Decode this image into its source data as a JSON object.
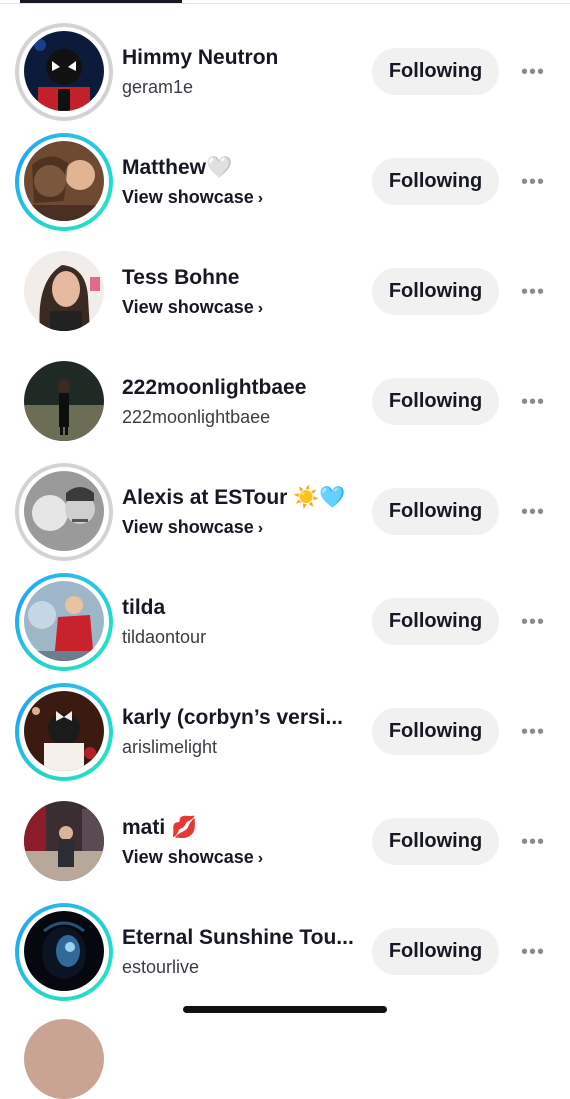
{
  "following_list": [
    {
      "name": "Himmy Neutron",
      "sub": "geram1e",
      "sub_type": "username",
      "ring": "seen",
      "button": "Following",
      "avatar": "spider-hero",
      "colors": [
        "#0d1b3a",
        "#c2202a",
        "#1a3f8a"
      ]
    },
    {
      "name": "Matthew🤍",
      "sub": "View showcase",
      "sub_type": "showcase",
      "ring": "story",
      "button": "Following",
      "avatar": "group-selfie",
      "colors": [
        "#6e4a32",
        "#d9a679",
        "#3a2418"
      ]
    },
    {
      "name": "Tess Bohne",
      "sub": "View showcase",
      "sub_type": "showcase",
      "ring": "none",
      "button": "Following",
      "avatar": "portrait",
      "colors": [
        "#f2ede8",
        "#3b2a22",
        "#e4b9a0"
      ]
    },
    {
      "name": "222moonlightbaee",
      "sub": "222moonlightbaee",
      "sub_type": "username",
      "ring": "none",
      "button": "Following",
      "avatar": "outdoor-night",
      "colors": [
        "#1f2a25",
        "#6b6e55",
        "#0e0e0e"
      ]
    },
    {
      "name": "Alexis at ESTour ☀️🩵",
      "sub": "View showcase",
      "sub_type": "showcase",
      "ring": "seen",
      "button": "Following",
      "avatar": "bw-duo",
      "colors": [
        "#9a9a9a",
        "#e6e6e6",
        "#3a3a3a"
      ]
    },
    {
      "name": "tilda",
      "sub": "tildaontour",
      "sub_type": "username",
      "ring": "story",
      "button": "Following",
      "avatar": "red-dress",
      "colors": [
        "#9fb6c9",
        "#c8232c",
        "#f2e1d6"
      ]
    },
    {
      "name": "karly (corbyn’s versi...",
      "sub": "arislimelight",
      "sub_type": "username",
      "ring": "story",
      "button": "Following",
      "avatar": "bow-hair",
      "colors": [
        "#3b1a10",
        "#d9b38c",
        "#f5f0ea"
      ]
    },
    {
      "name": "mati 💋",
      "sub": "View showcase",
      "sub_type": "showcase",
      "ring": "none",
      "button": "Following",
      "avatar": "city-street",
      "colors": [
        "#3a2e33",
        "#8b1d2a",
        "#b8a89a"
      ]
    },
    {
      "name": "Eternal Sunshine Tou...",
      "sub": "estourlive",
      "sub_type": "username",
      "ring": "story",
      "button": "Following",
      "avatar": "blue-glow",
      "colors": [
        "#05080f",
        "#3b7fb8",
        "#9fd2f2"
      ]
    }
  ],
  "more_icon": "more-dots-icon",
  "chevron_icon": "chevron-right-icon"
}
